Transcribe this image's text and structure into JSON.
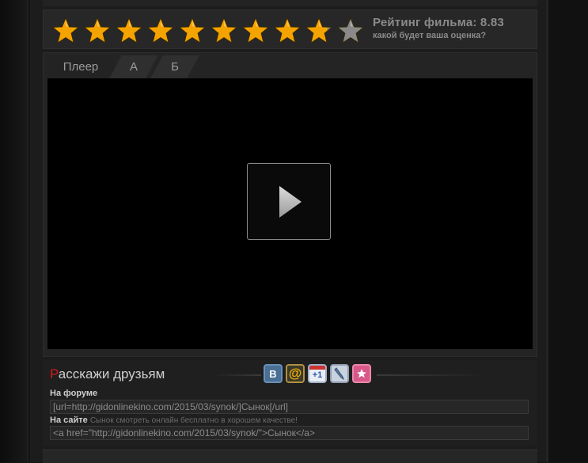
{
  "rating": {
    "stars_total": 10,
    "value": 8.83,
    "label": "Рейтинг фильма: 8.83",
    "prompt": "какой будет ваша оценка?"
  },
  "player": {
    "tabs": [
      {
        "label": "Плеер",
        "active": true
      },
      {
        "label": "А",
        "active": false
      },
      {
        "label": "Б",
        "active": false
      }
    ]
  },
  "share": {
    "title_first_letter": "Р",
    "title_rest": "асскажи друзьям",
    "icons": [
      "vk-icon",
      "mail-ru-icon",
      "google-plus-icon",
      "livejournal-icon",
      "favorites-icon"
    ],
    "vk_glyph": "B",
    "mail_glyph": "@",
    "plus_glyph": "+1",
    "forum_label": "На форуме",
    "forum_code": "[url=http://gidonlinekino.com/2015/03/synok/]Сынок[/url]",
    "site_label": "На сайте",
    "site_hint": "Сынок смотреть онлайн бесплатно в хорошем качестве!",
    "site_code": "<a href=\"http://gidonlinekino.com/2015/03/synok/\">Сынок</a>"
  },
  "colors": {
    "star_gold": "#f5a300",
    "star_gray": "#8a8a8a",
    "accent_red": "#d21b1b"
  }
}
